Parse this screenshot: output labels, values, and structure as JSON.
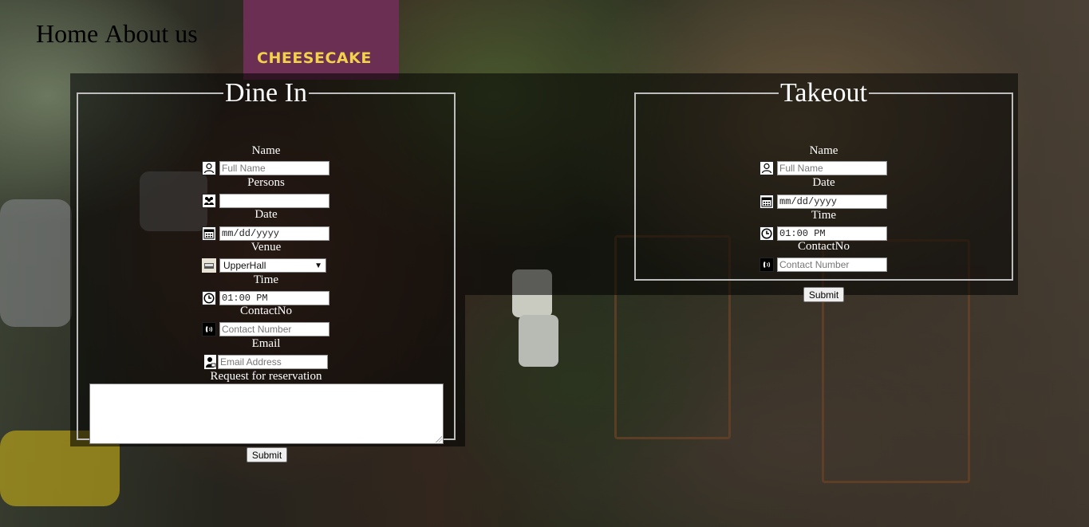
{
  "nav": {
    "home": "Home",
    "about": "About us"
  },
  "background": {
    "sign_text": "CHEESECAKE"
  },
  "dine_in": {
    "title": "Dine In",
    "name_label": "Name",
    "name_placeholder": "Full Name",
    "persons_label": "Persons",
    "persons_value": "",
    "date_label": "Date",
    "date_value": "mm/dd/yyyy",
    "venue_label": "Venue",
    "venue_selected": "UpperHall",
    "time_label": "Time",
    "time_value": "01:00 PM",
    "contact_label": "ContactNo",
    "contact_placeholder": "Contact Number",
    "email_label": "Email",
    "email_placeholder": "Email Address",
    "request_label": "Request for reservation",
    "request_value": "",
    "submit_label": "Submit"
  },
  "takeout": {
    "title": "Takeout",
    "name_label": "Name",
    "name_placeholder": "Full Name",
    "date_label": "Date",
    "date_value": "mm/dd/yyyy",
    "time_label": "Time",
    "time_value": "01:00 PM",
    "contact_label": "ContactNo",
    "contact_placeholder": "Contact Number",
    "submit_label": "Submit"
  },
  "icons": {
    "name": "user-icon",
    "persons": "group-icon",
    "date": "calendar-icon",
    "venue": "venue-icon",
    "time": "clock-icon",
    "contact": "phone-icon",
    "email": "person-email-icon",
    "select_arrow": "chevron-down-icon"
  }
}
